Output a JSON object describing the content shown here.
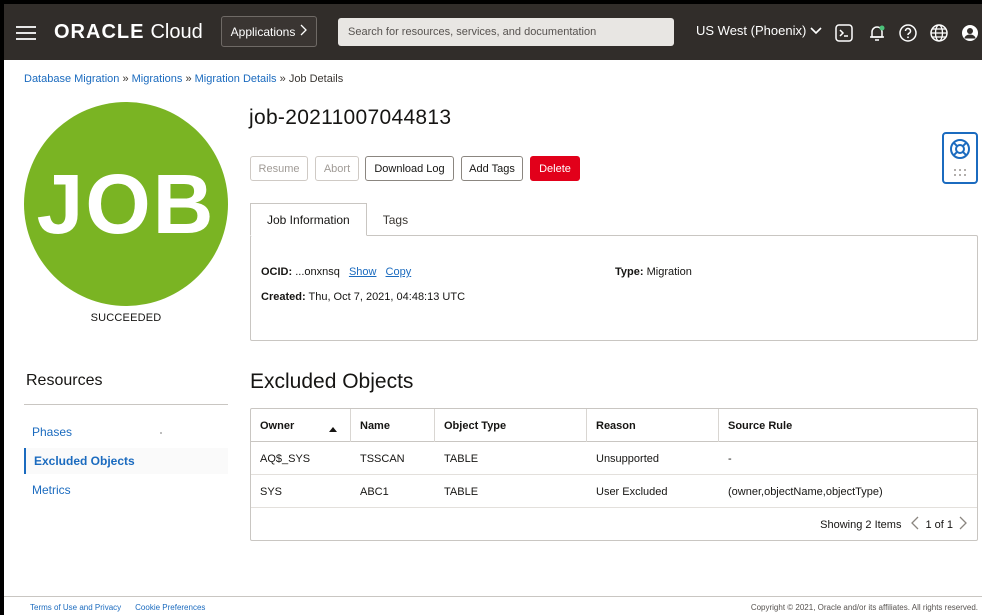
{
  "header": {
    "brand": "ORACLE",
    "product": "Cloud",
    "applications_label": "Applications",
    "search_placeholder": "Search for resources, services, and documentation",
    "region": "US West (Phoenix)"
  },
  "breadcrumb": [
    {
      "label": "Database Migration",
      "link": true
    },
    {
      "label": "Migrations",
      "link": true
    },
    {
      "label": "Migration Details",
      "link": true
    },
    {
      "label": "Job Details",
      "link": false
    }
  ],
  "breadcrumb_sep": "»",
  "job": {
    "badge_text": "JOB",
    "badge_color": "#7ab423",
    "status": "SUCCEEDED",
    "title": "job-20211007044813"
  },
  "actions": {
    "resume": "Resume",
    "abort": "Abort",
    "download_log": "Download Log",
    "add_tags": "Add Tags",
    "delete": "Delete"
  },
  "tabs": {
    "job_information": "Job Information",
    "tags": "Tags"
  },
  "info": {
    "ocid_label": "OCID:",
    "ocid_value": "...onxnsq",
    "show": "Show",
    "copy": "Copy",
    "type_label": "Type:",
    "type_value": "Migration",
    "created_label": "Created:",
    "created_value": "Thu, Oct 7, 2021, 04:48:13 UTC"
  },
  "resources": {
    "title": "Resources",
    "items": [
      {
        "label": "Phases"
      },
      {
        "label": "Excluded Objects"
      },
      {
        "label": "Metrics"
      }
    ]
  },
  "excluded": {
    "title": "Excluded Objects",
    "columns": [
      "Owner",
      "Name",
      "Object Type",
      "Reason",
      "Source Rule"
    ],
    "rows": [
      [
        "AQ$_SYS",
        "TSSCAN",
        "TABLE",
        "Unsupported",
        "-"
      ],
      [
        "SYS",
        "ABC1",
        "TABLE",
        "User Excluded",
        "(owner,objectName,objectType)"
      ]
    ],
    "showing": "Showing 2 Items",
    "pager": "1 of 1"
  },
  "footer": {
    "terms": "Terms of Use and Privacy",
    "cookies": "Cookie Preferences",
    "copyright": "Copyright © 2021, Oracle and/or its affiliates. All rights reserved."
  },
  "colors": {
    "header_bg": "#312d2a",
    "link": "#1b6bbf",
    "danger": "#e2001a",
    "success": "#7ab423"
  }
}
